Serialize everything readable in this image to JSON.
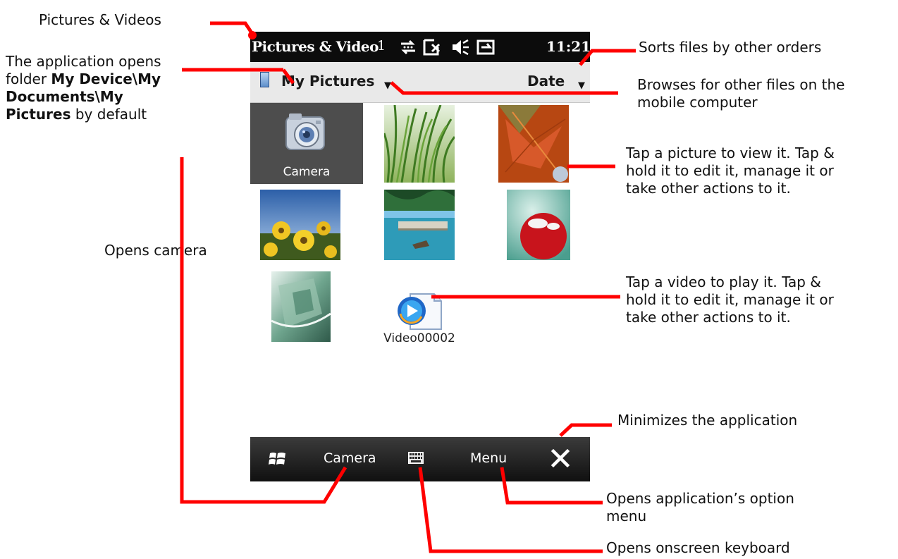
{
  "device": {
    "title": "Pictures & Video",
    "signal_digit": "1",
    "clock": "11:21",
    "folder_label": "My Pictures",
    "sort_label": "Date",
    "camera_tile_label": "Camera",
    "video_label": "Video00002",
    "softkey_left": "Camera",
    "softkey_right": "Menu"
  },
  "annotations": {
    "pictures_videos": "Pictures & Videos",
    "default_folder_1": "The application opens",
    "default_folder_2a": "folder ",
    "default_folder_2b": "My Device\\My",
    "default_folder_3": "Documents\\My",
    "default_folder_4a": "Pictures",
    "default_folder_4b": " by default",
    "opens_camera": "Opens camera",
    "sorts": "Sorts files by other orders",
    "browses_1": "Browses for other files on the",
    "browses_2": "mobile computer",
    "tap_picture_1": "Tap a picture to view it. Tap &",
    "tap_picture_2": "hold it to edit it, manage it or",
    "tap_picture_3": "take other actions to it.",
    "tap_video_1": "Tap a video to play it. Tap &",
    "tap_video_2": "hold it to edit it, manage it or",
    "tap_video_3": "take other actions to it.",
    "minimizes": "Minimizes the application",
    "option_menu_1": "Opens application’s option",
    "option_menu_2": "menu",
    "keyboard": "Opens onscreen keyboard"
  },
  "colors": {
    "leader_lines": "#ff0000",
    "title_bar": "#0c0c0c",
    "selected_tile": "#4d4d4d",
    "folder_bar": "#e9e9e9"
  },
  "icons": [
    "windows-start-icon",
    "keyboard-icon",
    "close-icon",
    "camera-icon",
    "video-file-icon",
    "device-icon",
    "sync-icon",
    "signal-icon",
    "volume-icon",
    "battery-icon"
  ]
}
